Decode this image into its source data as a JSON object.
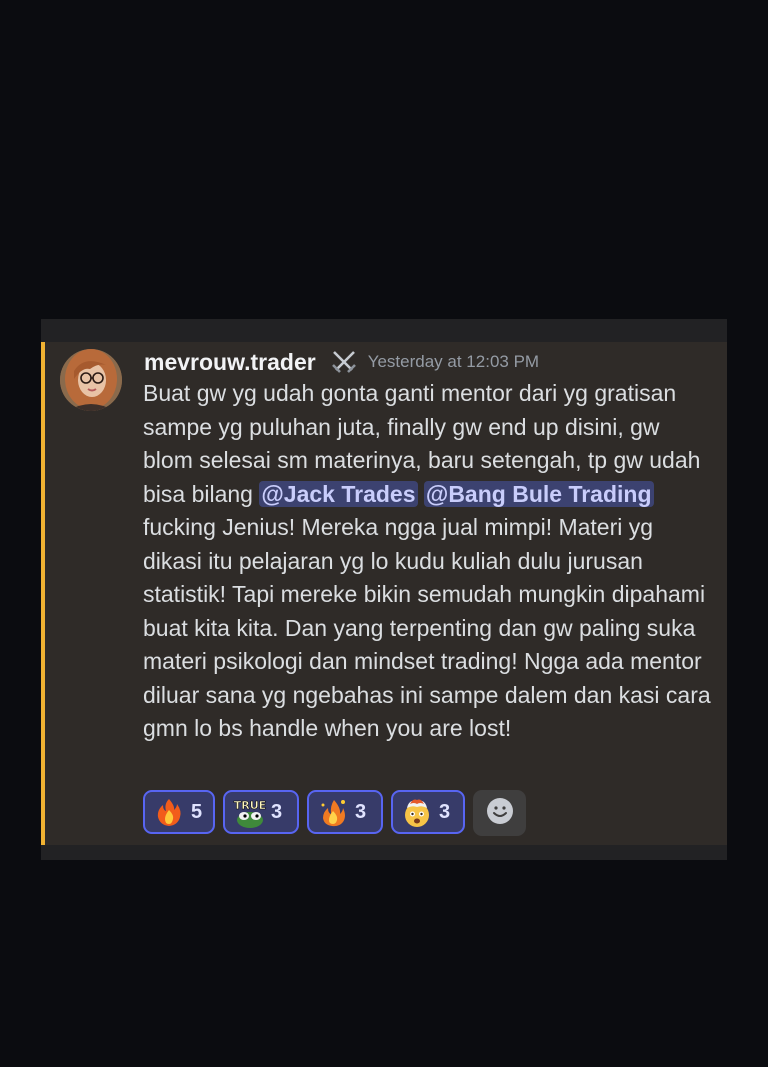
{
  "message": {
    "username": "mevrouw.trader",
    "role_icon": "crossed-swords-icon",
    "timestamp": "Yesterday at 12:03 PM",
    "text_part1": "Buat gw yg udah gonta ganti mentor dari yg gratisan sampe yg puluhan juta, finally gw end up disini, gw blom selesai sm materinya, baru setengah, tp gw udah bisa bilang ",
    "mention1": "@Jack Trades",
    "mention2": "@Bang Bule Trading",
    "text_part2": " fucking Jenius! Mereka ngga jual mimpi! Materi yg dikasi itu pelajaran yg lo kudu kuliah dulu jurusan statistik! Tapi mereke bikin semudah mungkin dipahami buat kita kita. Dan yang terpenting dan gw paling suka materi psikologi dan mindset trading! Ngga ada mentor diluar sana yg ngebahas ini sampe dalem dan kasi cara gmn lo bs handle when you are lost!"
  },
  "reactions": [
    {
      "emoji": "fire-emoji",
      "count": "5"
    },
    {
      "emoji": "true-frog-emoji",
      "count": "3"
    },
    {
      "emoji": "flame-spark-emoji",
      "count": "3"
    },
    {
      "emoji": "exploding-head-emoji",
      "count": "3"
    }
  ],
  "add_reaction": {
    "icon": "add-reaction-smiley-icon"
  },
  "colors": {
    "background": "#0b0c10",
    "card": "#2f2b28",
    "highlight": "#f0b232",
    "mention_bg": "#3c4270",
    "mention_text": "#c9cdfb",
    "reaction_border": "#5865f2"
  }
}
